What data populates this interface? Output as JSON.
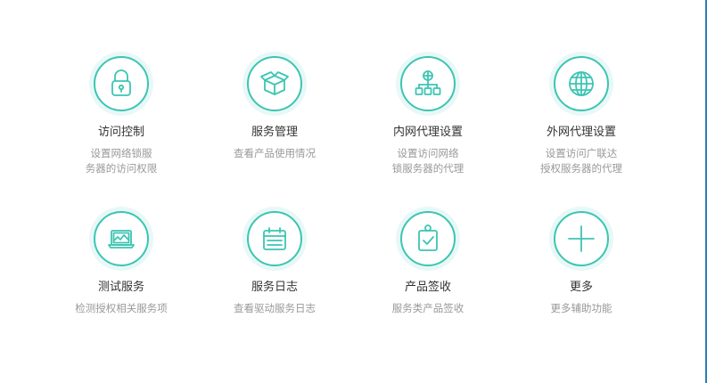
{
  "tiles": [
    {
      "title": "访问控制",
      "desc": "设置网络锁服\n务器的访问权限",
      "icon": "lock-icon"
    },
    {
      "title": "服务管理",
      "desc": "查看产品使用情况",
      "icon": "box-icon"
    },
    {
      "title": "内网代理设置",
      "desc": "设置访问网络\n锁服务器的代理",
      "icon": "network-icon"
    },
    {
      "title": "外网代理设置",
      "desc": "设置访问广联达\n授权服务器的代理",
      "icon": "globe-icon"
    },
    {
      "title": "测试服务",
      "desc": "检测授权相关服务项",
      "icon": "laptop-icon"
    },
    {
      "title": "服务日志",
      "desc": "查看驱动服务日志",
      "icon": "calendar-icon"
    },
    {
      "title": "产品签收",
      "desc": "服务类产品签收",
      "icon": "clipboard-check-icon"
    },
    {
      "title": "更多",
      "desc": "更多辅助功能",
      "icon": "plus-icon"
    }
  ],
  "colors": {
    "accent": "#3cc5b3",
    "ring": "#e8f8f6",
    "title": "#333333",
    "desc": "#999999",
    "border": "#2a7fb8"
  }
}
